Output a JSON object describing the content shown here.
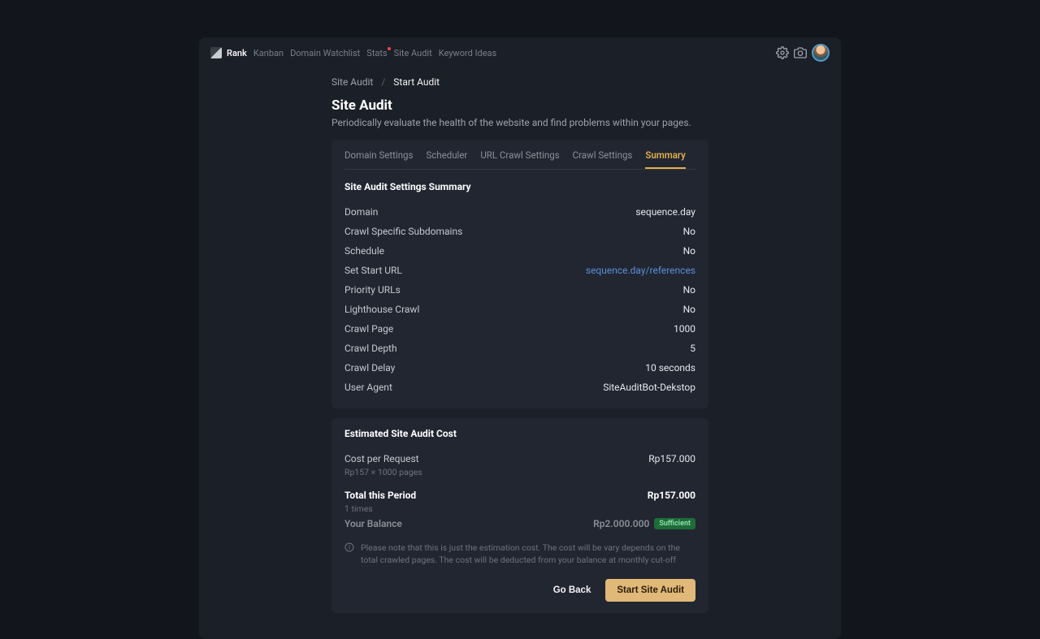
{
  "nav": {
    "items": [
      {
        "label": "Rank",
        "active": true
      },
      {
        "label": "Kanban"
      },
      {
        "label": "Domain Watchlist"
      },
      {
        "label": "Stats",
        "dot": true
      },
      {
        "label": "Site Audit"
      },
      {
        "label": "Keyword Ideas"
      }
    ]
  },
  "breadcrumb": {
    "parent": "Site Audit",
    "current": "Start Audit"
  },
  "page": {
    "title": "Site Audit",
    "subtitle": "Periodically evaluate the health of the website and find problems within your pages."
  },
  "tabs": [
    {
      "label": "Domain Settings"
    },
    {
      "label": "Scheduler"
    },
    {
      "label": "URL Crawl Settings"
    },
    {
      "label": "Crawl Settings"
    },
    {
      "label": "Summary",
      "active": true
    }
  ],
  "summary": {
    "heading": "Site Audit Settings Summary",
    "rows": [
      {
        "label": "Domain",
        "value": "sequence.day"
      },
      {
        "label": "Crawl Specific Subdomains",
        "value": "No"
      },
      {
        "label": "Schedule",
        "value": "No"
      },
      {
        "label": "Set Start URL",
        "value": "sequence.day/references",
        "link": true
      },
      {
        "label": "Priority URLs",
        "value": "No"
      },
      {
        "label": "Lighthouse Crawl",
        "value": "No"
      },
      {
        "label": "Crawl Page",
        "value": "1000"
      },
      {
        "label": "Crawl Depth",
        "value": "5"
      },
      {
        "label": "Crawl Delay",
        "value": "10 seconds"
      },
      {
        "label": "User Agent",
        "value": "SiteAuditBot-Dekstop"
      }
    ]
  },
  "cost": {
    "heading": "Estimated Site Audit Cost",
    "per_request_label": "Cost per Request",
    "per_request_value": "Rp157.000",
    "per_request_sub": "Rp157 × 1000 pages",
    "total_label": "Total this Period",
    "total_value": "Rp157.000",
    "total_sub": "1 times",
    "balance_label": "Your Balance",
    "balance_value": "Rp2.000.000",
    "balance_badge": "Sufficient",
    "note": "Please note that this is just the estimation cost. The cost will be vary depends on the total crawled pages. The cost will be deducted from your balance at monthly cut-off"
  },
  "actions": {
    "back": "Go Back",
    "start": "Start Site Audit"
  }
}
